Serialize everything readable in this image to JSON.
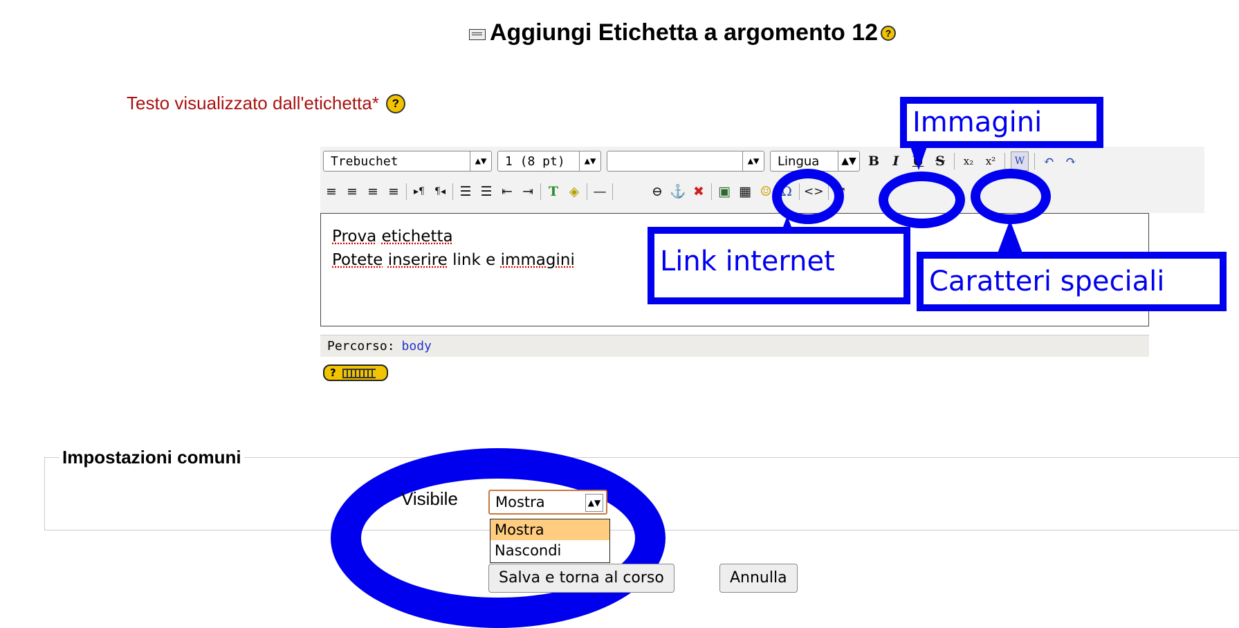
{
  "page": {
    "title": "Aggiungi Etichetta a argomento 12",
    "help_glyph": "?"
  },
  "label_field": {
    "label": "Testo visualizzato dall'etichetta*"
  },
  "editor": {
    "font_select": "Trebuchet",
    "size_select": "1 (8 pt)",
    "style_select": "",
    "lang_select": "Lingua",
    "row1_buttons": [
      "B",
      "I",
      "U",
      "S",
      "x₂",
      "x²",
      "W",
      "↶",
      "↷"
    ],
    "row2_buttons": [
      "≡",
      "≡",
      "≡",
      "≡",
      "▸¶",
      "¶◂",
      "☰",
      "☰",
      "⇤",
      "⇥",
      "T",
      "◈",
      "—",
      "⊖",
      "⚓",
      "✖",
      "▣",
      "▦",
      "☺",
      "Ω",
      "<>",
      "⤢"
    ],
    "content_line1_words": [
      "Prova",
      "etichetta"
    ],
    "content_line2": {
      "w1": "Potete",
      "w2": "inserire",
      "w3": "link e",
      "w4": "immagini"
    },
    "path_label": "Percorso:",
    "path_value": "body",
    "kbd_help": "?"
  },
  "annotations": {
    "immagini": "Immagini",
    "link": "Link internet",
    "caratteri": "Caratteri speciali",
    "color": "#0000ee"
  },
  "settings": {
    "legend": "Impostazioni comuni",
    "visible_label": "Visibile",
    "visible_value": "Mostra",
    "options": [
      "Mostra",
      "Nascondi"
    ],
    "save_button": "Salva e torna al corso",
    "cancel_button": "Annulla"
  }
}
